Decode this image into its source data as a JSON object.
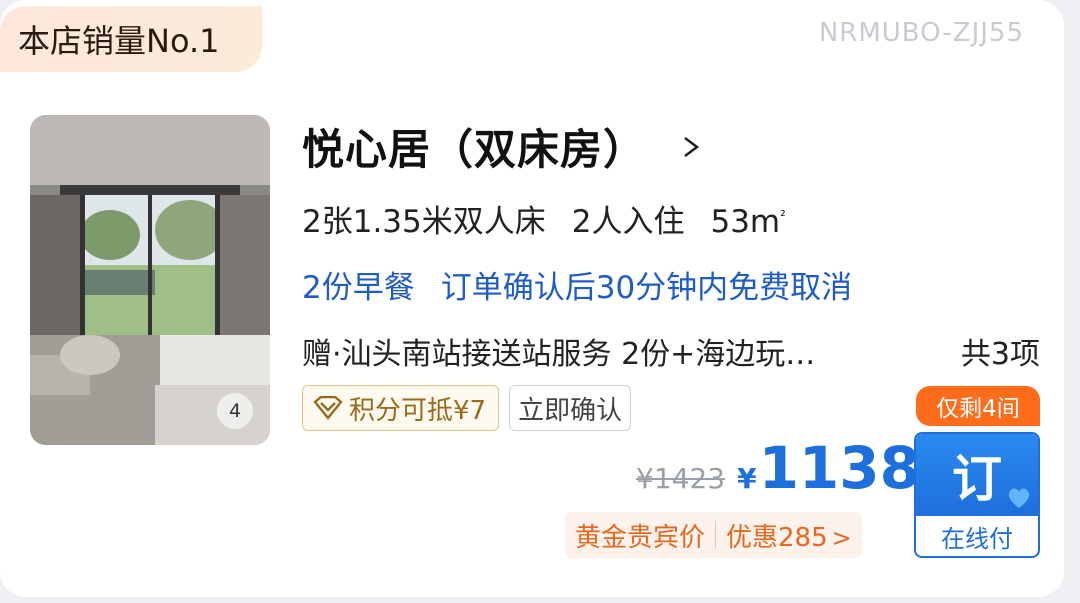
{
  "rank_badge": "本店销量No.1",
  "room_code": "NRMUBO-ZJJ55",
  "room": {
    "name": "悦心居（双床房）",
    "beds": "2张1.35米双人床",
    "occupancy": "2人入住",
    "area": "53m",
    "area_unit_sup": "²",
    "breakfast": "2份早餐",
    "cancellation": "订单确认后30分钟内免费取消",
    "gifts": "赠·汕头南站接送站服务 2份+海边玩…",
    "gifts_count": "共3项",
    "photo_count": "4"
  },
  "tags": {
    "points": "积分可抵¥7",
    "confirm": "立即确认"
  },
  "price": {
    "original": "¥1423",
    "currency": "¥",
    "current": "1138"
  },
  "promo": {
    "label": "黄金贵宾价",
    "discount": "优惠285",
    "arrow": ">"
  },
  "stock_badge": "仅剩4间",
  "book_button": {
    "main": "订",
    "sub": "在线付"
  },
  "colors": {
    "accent_blue": "#1e6fdb",
    "orange": "#ff6d1c",
    "gold": "#9a6a1a"
  },
  "icons": {
    "chevron": "chevron-right-icon",
    "gem": "diamond-icon",
    "heart": "heart-icon"
  }
}
